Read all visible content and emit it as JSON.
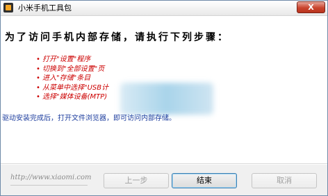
{
  "window": {
    "title": "小米手机工具包",
    "close_label": "X"
  },
  "content": {
    "heading": "为了访问手机内部存储，请执行下列步骤：",
    "bullet_glyph": "•",
    "steps": [
      "打开\"设置\"程序",
      "切换到\"全部设置\"页",
      "进入\"存储\"条目",
      "从菜单中选择\"USB计",
      "选择\"媒体设备(MTP)"
    ],
    "info": "驱动安装完成后，打开文件浏览器，即可访问内部存储。"
  },
  "footer": {
    "url": "http://www.xiaomi.com",
    "prev_label": "上一步",
    "finish_label": "结束",
    "cancel_label": "取消"
  }
}
